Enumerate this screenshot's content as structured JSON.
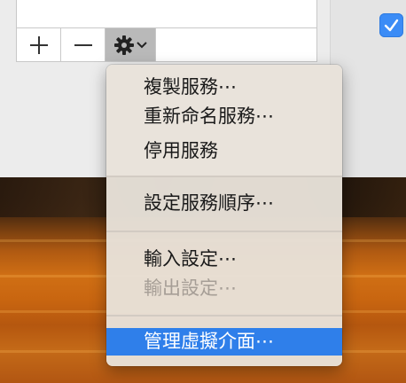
{
  "toolbar": {
    "add_symbol": "+",
    "remove_symbol": "−",
    "gear_icon": "gear-icon",
    "dropdown_icon": "chevron-down-icon"
  },
  "checkbox": {
    "checked": true,
    "color": "#3b8cf6"
  },
  "menu": {
    "items": [
      {
        "label": "複製服務⋯",
        "enabled": true
      },
      {
        "label": "重新命名服務⋯",
        "enabled": true
      },
      {
        "label": "停用服務",
        "enabled": true
      },
      {
        "label": "設定服務順序⋯",
        "enabled": true
      },
      {
        "label": "輸入設定⋯",
        "enabled": true
      },
      {
        "label": "輸出設定⋯",
        "enabled": false
      },
      {
        "label": "管理虛擬介面⋯",
        "enabled": true,
        "selected": true
      }
    ],
    "selection_color": "#2f7fea"
  }
}
